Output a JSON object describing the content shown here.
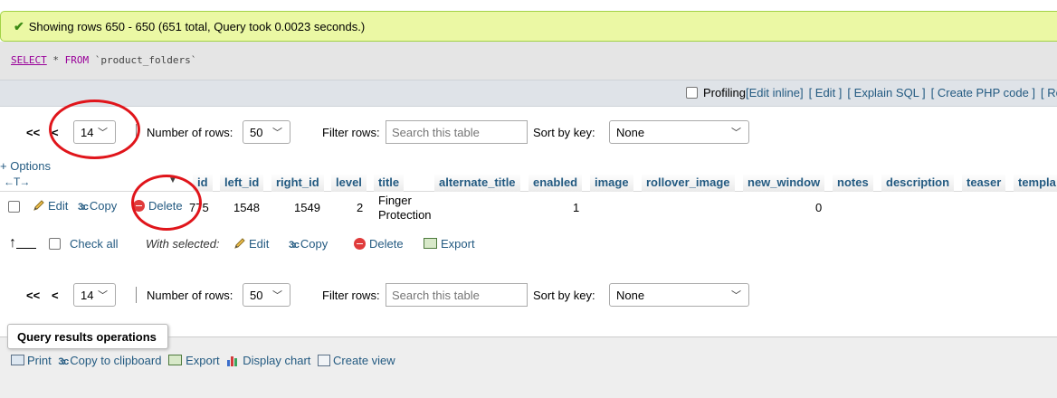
{
  "message": {
    "text": "Showing rows 650 - 650 (651 total, Query took 0.0023 seconds.)"
  },
  "sql": {
    "select": "SELECT",
    "star": "*",
    "from": "FROM",
    "table": "`product_folders`"
  },
  "tools": {
    "profiling": "Profiling",
    "edit_inline": "[Edit inline]",
    "edit": "[ Edit ]",
    "explain": "[ Explain SQL ]",
    "php": "[ Create PHP code ]",
    "refresh": "[ Re"
  },
  "nav_top": {
    "first": "<<",
    "prev": "<",
    "page": "14",
    "rows_label": "Number of rows:",
    "rows_value": "50",
    "filter_label": "Filter rows:",
    "filter_placeholder": "Search this table",
    "sort_label": "Sort by key:",
    "sort_value": "None"
  },
  "nav_bottom": {
    "first": "<<",
    "prev": "<",
    "page": "14",
    "rows_label": "Number of rows:",
    "rows_value": "50",
    "filter_label": "Filter rows:",
    "filter_placeholder": "Search this table",
    "sort_label": "Sort by key:",
    "sort_value": "None"
  },
  "options_label": "+ Options",
  "arrows": "←T→",
  "columns": [
    "id",
    "left_id",
    "right_id",
    "level",
    "title",
    "alternate_title",
    "enabled",
    "image",
    "rollover_image",
    "new_window",
    "notes",
    "description",
    "teaser",
    "templa"
  ],
  "row": {
    "edit": "Edit",
    "copy": "Copy",
    "delete": "Delete",
    "id": "775",
    "left_id": "1548",
    "right_id": "1549",
    "level": "2",
    "title_1": "Finger",
    "title_2": "Protection",
    "enabled": "1",
    "new_window": "0"
  },
  "with_selected": {
    "check_all": "Check all",
    "label": "With selected:",
    "edit": "Edit",
    "copy": "Copy",
    "delete": "Delete",
    "export": "Export"
  },
  "query_ops": {
    "title": "Query results operations",
    "print": "Print",
    "copy_clip": "Copy to clipboard",
    "export": "Export",
    "chart": "Display chart",
    "view": "Create view"
  }
}
